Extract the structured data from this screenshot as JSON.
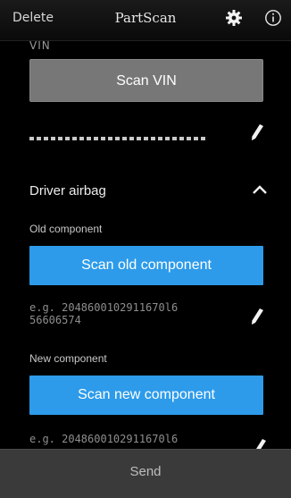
{
  "topbar": {
    "delete_label": "Delete",
    "title": "PartScan",
    "settings_icon": "gear-icon",
    "info_icon": "info-icon"
  },
  "vin": {
    "label": "VIN",
    "scan_button": "Scan VIN",
    "value": "•••••••••••••••••",
    "edit_icon": "pencil-icon"
  },
  "section": {
    "title": "Driver airbag",
    "toggle_icon": "chevron-up-icon"
  },
  "old_component": {
    "label": "Old component",
    "scan_button": "Scan old component",
    "placeholder_line1": "e.g. 2048600102911670l6",
    "placeholder_line2": "56606574",
    "edit_icon": "pencil-icon"
  },
  "new_component": {
    "label": "New component",
    "scan_button": "Scan new component",
    "placeholder": "e.g. 2048600102911670l6",
    "edit_icon": "pencil-icon"
  },
  "footer": {
    "send_label": "Send"
  },
  "colors": {
    "accent_blue": "#2d9bea",
    "button_gray": "#777777",
    "background": "#000000",
    "footer": "#3a3a3a"
  }
}
